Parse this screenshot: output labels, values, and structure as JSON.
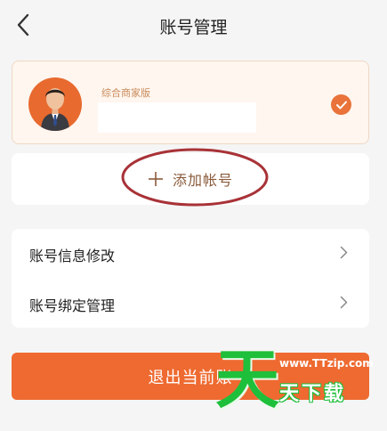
{
  "header": {
    "title": "账号管理"
  },
  "account": {
    "edition": "综合商家版"
  },
  "add_account": {
    "label": "添加帐号"
  },
  "menu": {
    "items": [
      {
        "label": "账号信息修改"
      },
      {
        "label": "账号绑定管理"
      }
    ]
  },
  "logout": {
    "label": "退出当前账"
  },
  "watermark": {
    "big_char": "天",
    "url": "www.TTzip.com",
    "text": "天下载"
  },
  "colors": {
    "accent": "#ee6a30",
    "annotation": "#a83237",
    "watermark": "#1ebf3a"
  }
}
